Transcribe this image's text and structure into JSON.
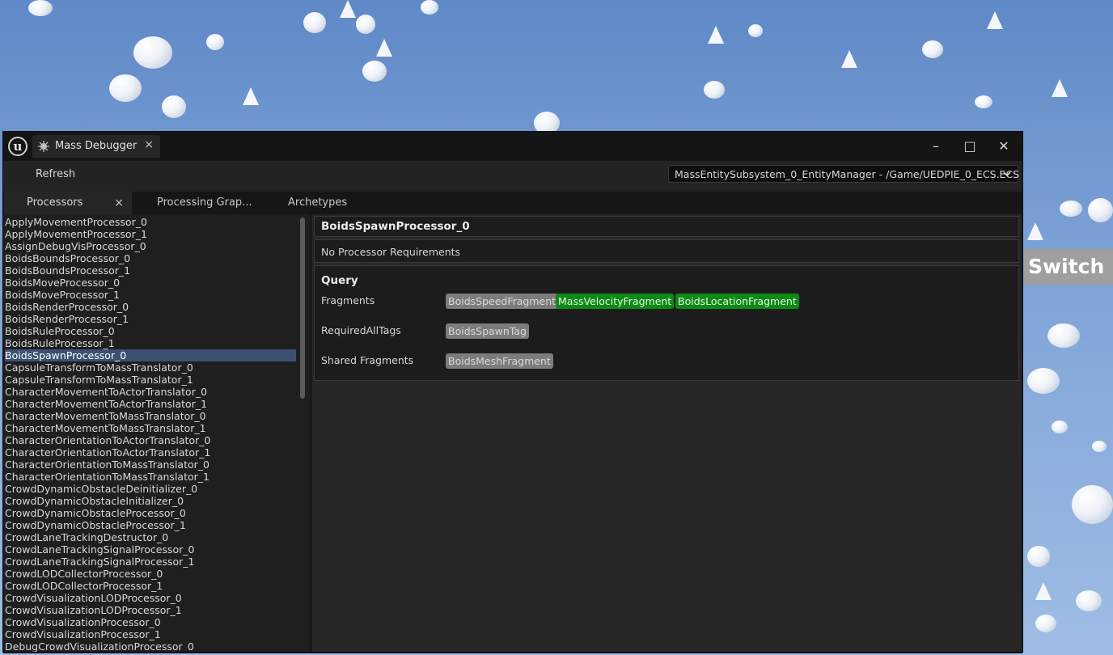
{
  "window": {
    "tab_title": "Mass Debugger",
    "tab_close": "×",
    "minimize": "–",
    "maximize": "□",
    "close": "✕"
  },
  "toolbar": {
    "refresh_label": "Refresh",
    "entity_manager": "MassEntitySubsystem_0_EntityManager - /Game/UEDPIE_0_ECS.ECS",
    "dropdown_icon": "chevron-down-icon"
  },
  "tabs": [
    {
      "label": "Processors",
      "close": "×"
    },
    {
      "label": "Processing Grap..."
    },
    {
      "label": "Archetypes"
    }
  ],
  "overlay_button": "Switch",
  "processors": [
    "ApplyMovementProcessor_0",
    "ApplyMovementProcessor_1",
    "AssignDebugVisProcessor_0",
    "BoidsBoundsProcessor_0",
    "BoidsBoundsProcessor_1",
    "BoidsMoveProcessor_0",
    "BoidsMoveProcessor_1",
    "BoidsRenderProcessor_0",
    "BoidsRenderProcessor_1",
    "BoidsRuleProcessor_0",
    "BoidsRuleProcessor_1",
    "BoidsSpawnProcessor_0",
    "CapsuleTransformToMassTranslator_0",
    "CapsuleTransformToMassTranslator_1",
    "CharacterMovementToActorTranslator_0",
    "CharacterMovementToActorTranslator_1",
    "CharacterMovementToMassTranslator_0",
    "CharacterMovementToMassTranslator_1",
    "CharacterOrientationToActorTranslator_0",
    "CharacterOrientationToActorTranslator_1",
    "CharacterOrientationToMassTranslator_0",
    "CharacterOrientationToMassTranslator_1",
    "CrowdDynamicObstacleDeinitializer_0",
    "CrowdDynamicObstacleInitializer_0",
    "CrowdDynamicObstacleProcessor_0",
    "CrowdDynamicObstacleProcessor_1",
    "CrowdLaneTrackingDestructor_0",
    "CrowdLaneTrackingSignalProcessor_0",
    "CrowdLaneTrackingSignalProcessor_1",
    "CrowdLODCollectorProcessor_0",
    "CrowdLODCollectorProcessor_1",
    "CrowdVisualizationLODProcessor_0",
    "CrowdVisualizationLODProcessor_1",
    "CrowdVisualizationProcessor_0",
    "CrowdVisualizationProcessor_1",
    "DebugCrowdVisualizationProcessor_0"
  ],
  "selected_processor": "BoidsSpawnProcessor_0",
  "details": {
    "title": "BoidsSpawnProcessor_0",
    "requirements": "No Processor Requirements",
    "query_title": "Query",
    "fragments_label": "Fragments",
    "fragments": [
      {
        "name": "BoidsSpeedFragment",
        "color": "#7c7c7c"
      },
      {
        "name": "MassVelocityFragment",
        "color": "#0c8a13"
      },
      {
        "name": "BoidsLocationFragment",
        "color": "#0c8a13"
      }
    ],
    "tags_label": "RequiredAllTags",
    "tags": [
      {
        "name": "BoidsSpawnTag",
        "color": "#7c7c7c"
      }
    ],
    "shared_label": "Shared Fragments",
    "shared": [
      {
        "name": "BoidsMeshFragment",
        "color": "#7c7c7c"
      }
    ]
  }
}
